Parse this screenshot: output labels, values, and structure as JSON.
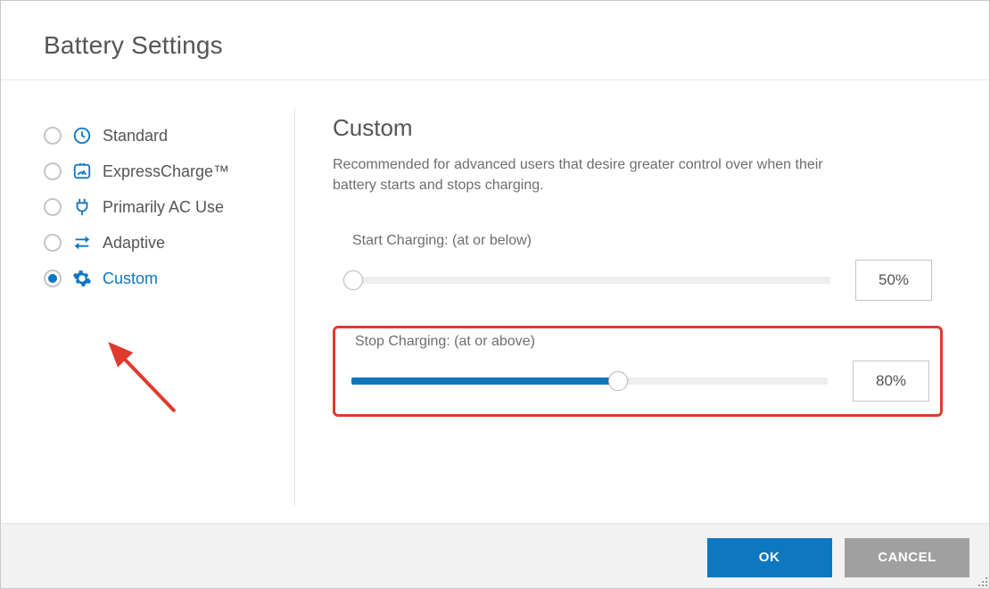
{
  "title": "Battery Settings",
  "options": {
    "standard": "Standard",
    "express": "ExpressCharge™",
    "ac": "Primarily AC Use",
    "adaptive": "Adaptive",
    "custom": "Custom"
  },
  "detail": {
    "heading": "Custom",
    "description": "Recommended for advanced users that desire greater control over when their battery starts and stops charging."
  },
  "sliders": {
    "start": {
      "label": "Start Charging: (at or below)",
      "value": "50%"
    },
    "stop": {
      "label": "Stop Charging: (at or above)",
      "value": "80%"
    }
  },
  "buttons": {
    "ok": "OK",
    "cancel": "CANCEL"
  }
}
